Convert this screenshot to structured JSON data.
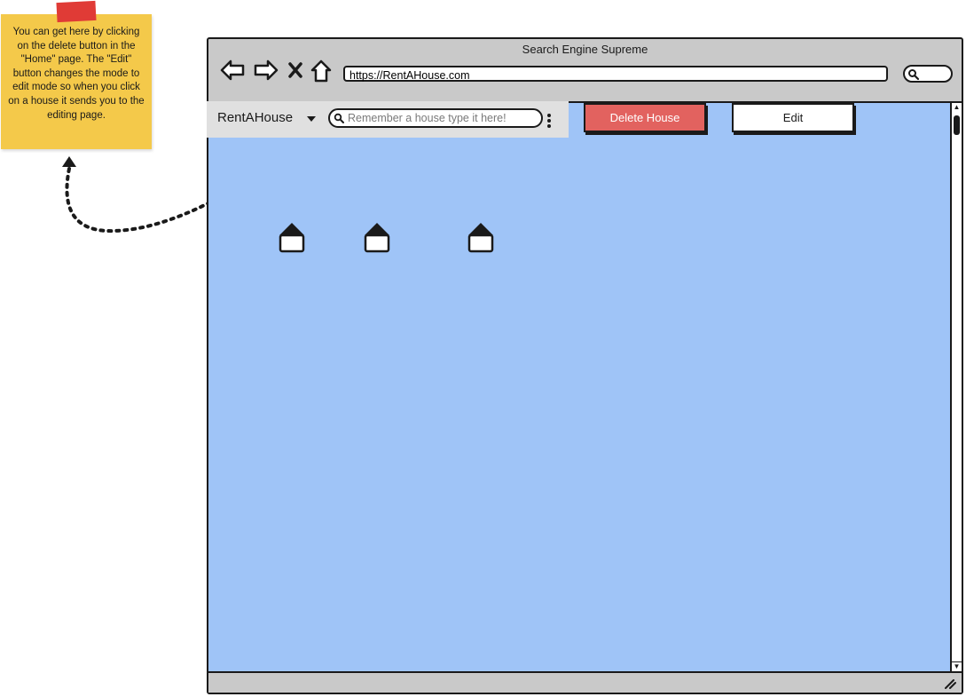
{
  "note": {
    "text": "You can get here by clicking on the delete button in the \"Home\" page. The \"Edit\" button changes the mode to edit mode so when you click on a house it sends you to the editing page."
  },
  "browser": {
    "title": "Search Engine Supreme",
    "url": "https://RentAHouse.com",
    "nav_icons": [
      "back-arrow-icon",
      "forward-arrow-icon",
      "close-x-icon",
      "home-icon"
    ]
  },
  "app": {
    "brand": "RentAHouse",
    "search_placeholder": "Remember a house type it here!",
    "delete_button": "Delete House",
    "edit_button": "Edit",
    "houses": [
      "house-icon",
      "house-icon",
      "house-icon"
    ]
  },
  "colors": {
    "content_bg": "#9fc4f7",
    "delete_button": "#e2625f",
    "note_bg": "#f4c94a",
    "tape": "#e03b36",
    "chrome": "#c9c9c9"
  }
}
